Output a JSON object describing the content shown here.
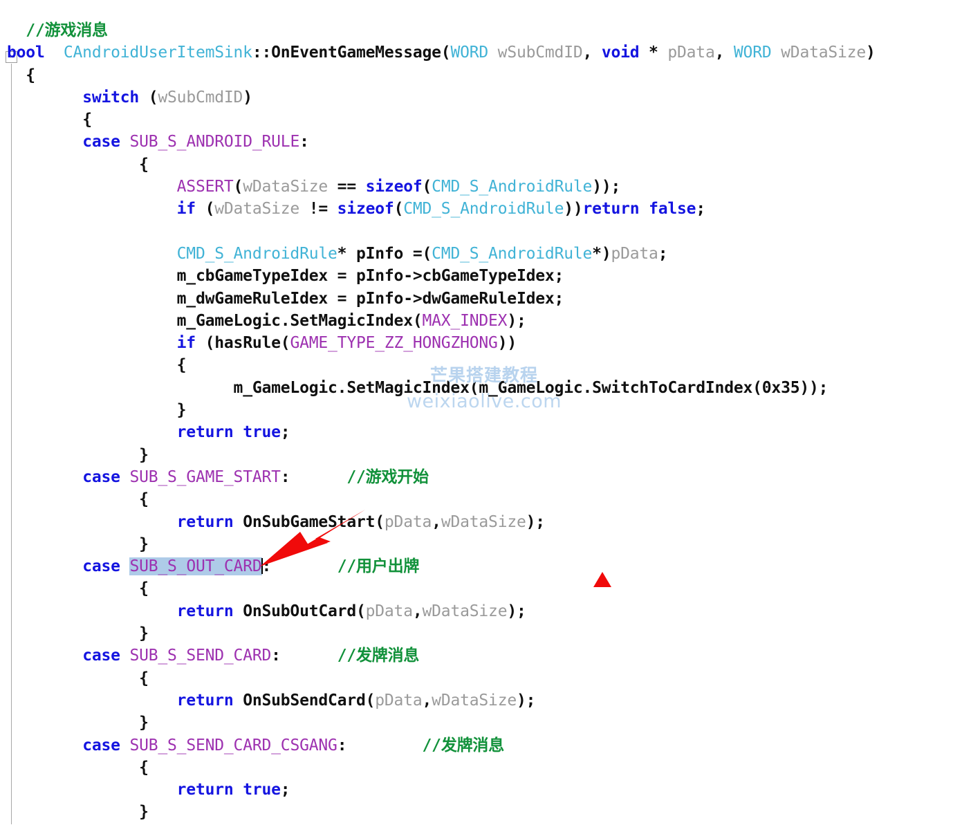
{
  "editor": {
    "title": "CAndroidUserItemSink::OnEventGameMessage",
    "language": "C++",
    "colors": {
      "background": "#ffffff",
      "comment": "#11913a",
      "keyword": "#1414e0",
      "macro": "#9d31b0",
      "usertype": "#41b3d6",
      "plain": "#101010",
      "parameter": "#9a9a9a",
      "selection": "#aecbe8",
      "annotation": "#f00a0a",
      "watermark": "#bcd6ef"
    }
  },
  "gutter": {
    "fold_marker": "collapse-minus",
    "fold_state": "expanded"
  },
  "code": {
    "lines": [
      {
        "indent": 1,
        "tokens": [
          {
            "t": "//游戏消息",
            "c": "comment"
          }
        ]
      },
      {
        "indent": 0,
        "tokens": [
          {
            "t": "bool",
            "c": "keyword"
          },
          {
            "t": "  ",
            "c": "plain"
          },
          {
            "t": "CAndroidUserItemSink",
            "c": "usertype"
          },
          {
            "t": "::OnEventGameMessage(",
            "c": "plain"
          },
          {
            "t": "WORD",
            "c": "usertype"
          },
          {
            "t": " wSubCmdID",
            "c": "param"
          },
          {
            "t": ", ",
            "c": "plain"
          },
          {
            "t": "void",
            "c": "keyword"
          },
          {
            "t": " * ",
            "c": "plain"
          },
          {
            "t": "pData",
            "c": "param"
          },
          {
            "t": ", ",
            "c": "plain"
          },
          {
            "t": "WORD",
            "c": "usertype"
          },
          {
            "t": " wDataSize",
            "c": "param"
          },
          {
            "t": ")",
            "c": "plain"
          }
        ]
      },
      {
        "indent": 1,
        "tokens": [
          {
            "t": "{",
            "c": "plain"
          }
        ]
      },
      {
        "indent": 4,
        "tokens": [
          {
            "t": "switch",
            "c": "keyword"
          },
          {
            "t": " (",
            "c": "plain"
          },
          {
            "t": "wSubCmdID",
            "c": "param"
          },
          {
            "t": ")",
            "c": "plain"
          }
        ]
      },
      {
        "indent": 4,
        "tokens": [
          {
            "t": "{",
            "c": "plain"
          }
        ]
      },
      {
        "indent": 4,
        "tokens": [
          {
            "t": "case",
            "c": "keyword"
          },
          {
            "t": " ",
            "c": "plain"
          },
          {
            "t": "SUB_S_ANDROID_RULE",
            "c": "macro"
          },
          {
            "t": ":",
            "c": "plain"
          }
        ]
      },
      {
        "indent": 7,
        "tokens": [
          {
            "t": "{",
            "c": "plain"
          }
        ]
      },
      {
        "indent": 9,
        "tokens": [
          {
            "t": "ASSERT",
            "c": "macro"
          },
          {
            "t": "(",
            "c": "plain"
          },
          {
            "t": "wDataSize",
            "c": "param"
          },
          {
            "t": " == ",
            "c": "plain"
          },
          {
            "t": "sizeof",
            "c": "keyword"
          },
          {
            "t": "(",
            "c": "plain"
          },
          {
            "t": "CMD_S_AndroidRule",
            "c": "usertype"
          },
          {
            "t": "));",
            "c": "plain"
          }
        ]
      },
      {
        "indent": 9,
        "tokens": [
          {
            "t": "if",
            "c": "keyword"
          },
          {
            "t": " (",
            "c": "plain"
          },
          {
            "t": "wDataSize",
            "c": "param"
          },
          {
            "t": " != ",
            "c": "plain"
          },
          {
            "t": "sizeof",
            "c": "keyword"
          },
          {
            "t": "(",
            "c": "plain"
          },
          {
            "t": "CMD_S_AndroidRule",
            "c": "usertype"
          },
          {
            "t": "))",
            "c": "plain"
          },
          {
            "t": "return",
            "c": "keyword"
          },
          {
            "t": " ",
            "c": "plain"
          },
          {
            "t": "false",
            "c": "keyword"
          },
          {
            "t": ";",
            "c": "plain"
          }
        ]
      },
      {
        "indent": 0,
        "tokens": []
      },
      {
        "indent": 9,
        "tokens": [
          {
            "t": "CMD_S_AndroidRule",
            "c": "usertype"
          },
          {
            "t": "* pInfo =(",
            "c": "plain"
          },
          {
            "t": "CMD_S_AndroidRule",
            "c": "usertype"
          },
          {
            "t": "*)",
            "c": "plain"
          },
          {
            "t": "pData",
            "c": "param"
          },
          {
            "t": ";",
            "c": "plain"
          }
        ]
      },
      {
        "indent": 9,
        "tokens": [
          {
            "t": "m_cbGameTypeIdex = pInfo->cbGameTypeIdex;",
            "c": "plain"
          }
        ]
      },
      {
        "indent": 9,
        "tokens": [
          {
            "t": "m_dwGameRuleIdex = pInfo->dwGameRuleIdex;",
            "c": "plain"
          }
        ]
      },
      {
        "indent": 9,
        "tokens": [
          {
            "t": "m_GameLogic.SetMagicIndex(",
            "c": "plain"
          },
          {
            "t": "MAX_INDEX",
            "c": "macro"
          },
          {
            "t": ");",
            "c": "plain"
          }
        ]
      },
      {
        "indent": 9,
        "tokens": [
          {
            "t": "if",
            "c": "keyword"
          },
          {
            "t": " (hasRule(",
            "c": "plain"
          },
          {
            "t": "GAME_TYPE_ZZ_HONGZHONG",
            "c": "macro"
          },
          {
            "t": "))",
            "c": "plain"
          }
        ]
      },
      {
        "indent": 9,
        "tokens": [
          {
            "t": "{",
            "c": "plain"
          }
        ]
      },
      {
        "indent": 12,
        "tokens": [
          {
            "t": "m_GameLogic.SetMagicIndex(m_GameLogic.SwitchToCardIndex(0x35));",
            "c": "plain"
          }
        ]
      },
      {
        "indent": 9,
        "tokens": [
          {
            "t": "}",
            "c": "plain"
          }
        ]
      },
      {
        "indent": 9,
        "tokens": [
          {
            "t": "return",
            "c": "keyword"
          },
          {
            "t": " ",
            "c": "plain"
          },
          {
            "t": "true",
            "c": "keyword"
          },
          {
            "t": ";",
            "c": "plain"
          }
        ]
      },
      {
        "indent": 7,
        "tokens": [
          {
            "t": "}",
            "c": "plain"
          }
        ]
      },
      {
        "indent": 4,
        "tokens": [
          {
            "t": "case",
            "c": "keyword"
          },
          {
            "t": " ",
            "c": "plain"
          },
          {
            "t": "SUB_S_GAME_START",
            "c": "macro"
          },
          {
            "t": ":",
            "c": "plain"
          },
          {
            "t": "      ",
            "c": "plain"
          },
          {
            "t": "//游戏开始",
            "c": "comment"
          }
        ]
      },
      {
        "indent": 7,
        "tokens": [
          {
            "t": "{",
            "c": "plain"
          }
        ]
      },
      {
        "indent": 9,
        "tokens": [
          {
            "t": "return",
            "c": "keyword"
          },
          {
            "t": " OnSubGameStart(",
            "c": "plain"
          },
          {
            "t": "pData",
            "c": "param"
          },
          {
            "t": ",",
            "c": "plain"
          },
          {
            "t": "wDataSize",
            "c": "param"
          },
          {
            "t": ");",
            "c": "plain"
          }
        ]
      },
      {
        "indent": 7,
        "tokens": [
          {
            "t": "}",
            "c": "plain"
          }
        ]
      },
      {
        "indent": 4,
        "selected_token": 2,
        "tokens": [
          {
            "t": "case",
            "c": "keyword"
          },
          {
            "t": " ",
            "c": "plain"
          },
          {
            "t": "SUB_S_OUT_CARD",
            "c": "macro"
          },
          {
            "t": ":",
            "c": "plain"
          },
          {
            "t": "       ",
            "c": "plain"
          },
          {
            "t": "//用户出牌",
            "c": "comment"
          }
        ]
      },
      {
        "indent": 7,
        "tokens": [
          {
            "t": "{",
            "c": "plain"
          }
        ]
      },
      {
        "indent": 9,
        "tokens": [
          {
            "t": "return",
            "c": "keyword"
          },
          {
            "t": " OnSubOutCard(",
            "c": "plain"
          },
          {
            "t": "pData",
            "c": "param"
          },
          {
            "t": ",",
            "c": "plain"
          },
          {
            "t": "wDataSize",
            "c": "param"
          },
          {
            "t": ");",
            "c": "plain"
          }
        ]
      },
      {
        "indent": 7,
        "tokens": [
          {
            "t": "}",
            "c": "plain"
          }
        ]
      },
      {
        "indent": 4,
        "tokens": [
          {
            "t": "case",
            "c": "keyword"
          },
          {
            "t": " ",
            "c": "plain"
          },
          {
            "t": "SUB_S_SEND_CARD",
            "c": "macro"
          },
          {
            "t": ":",
            "c": "plain"
          },
          {
            "t": "      ",
            "c": "plain"
          },
          {
            "t": "//发牌消息",
            "c": "comment"
          }
        ]
      },
      {
        "indent": 7,
        "tokens": [
          {
            "t": "{",
            "c": "plain"
          }
        ]
      },
      {
        "indent": 9,
        "tokens": [
          {
            "t": "return",
            "c": "keyword"
          },
          {
            "t": " OnSubSendCard(",
            "c": "plain"
          },
          {
            "t": "pData",
            "c": "param"
          },
          {
            "t": ",",
            "c": "plain"
          },
          {
            "t": "wDataSize",
            "c": "param"
          },
          {
            "t": ");",
            "c": "plain"
          }
        ]
      },
      {
        "indent": 7,
        "tokens": [
          {
            "t": "}",
            "c": "plain"
          }
        ]
      },
      {
        "indent": 4,
        "tokens": [
          {
            "t": "case",
            "c": "keyword"
          },
          {
            "t": " ",
            "c": "plain"
          },
          {
            "t": "SUB_S_SEND_CARD_CSGANG",
            "c": "macro"
          },
          {
            "t": ":",
            "c": "plain"
          },
          {
            "t": "        ",
            "c": "plain"
          },
          {
            "t": "//发牌消息",
            "c": "comment"
          }
        ]
      },
      {
        "indent": 7,
        "tokens": [
          {
            "t": "{",
            "c": "plain"
          }
        ]
      },
      {
        "indent": 9,
        "tokens": [
          {
            "t": "return",
            "c": "keyword"
          },
          {
            "t": " ",
            "c": "plain"
          },
          {
            "t": "true",
            "c": "keyword"
          },
          {
            "t": ";",
            "c": "plain"
          }
        ]
      },
      {
        "indent": 7,
        "tokens": [
          {
            "t": "}",
            "c": "plain"
          }
        ]
      }
    ]
  },
  "watermark": {
    "chinese": "芒果搭建教程",
    "url": "weixiaolive.com"
  },
  "annotations": {
    "arrow": "red-arrow-pointing-down-left",
    "triangle": "red-triangle-marker"
  }
}
